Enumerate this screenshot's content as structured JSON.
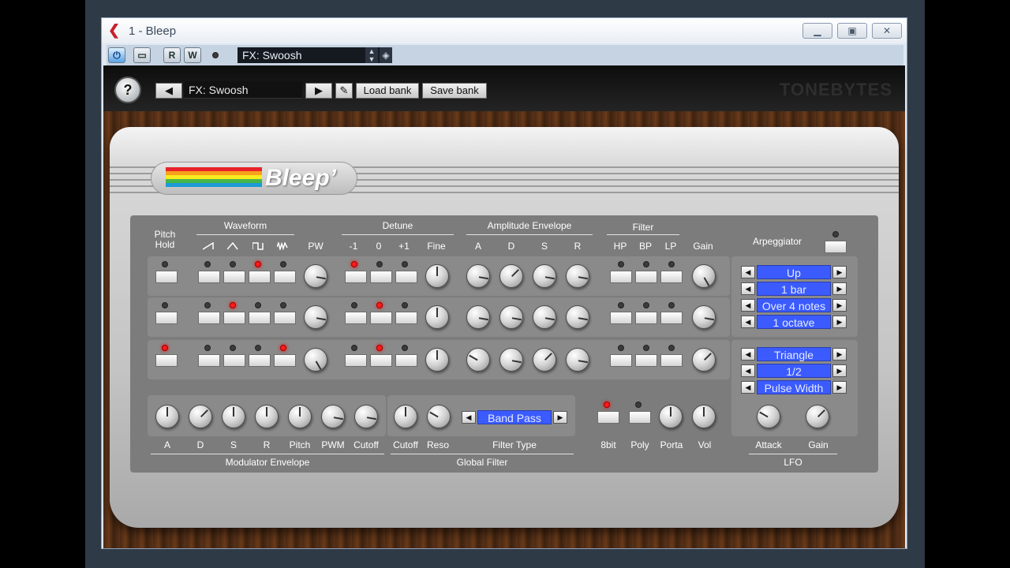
{
  "window": {
    "title": "1 - Bleep"
  },
  "toolbar": {
    "preset": "FX: Swoosh",
    "read_label": "R",
    "write_label": "W"
  },
  "plugin": {
    "preset_name": "FX: Swoosh",
    "load_label": "Load bank",
    "save_label": "Save bank",
    "brand": "TONEBYTES",
    "logo_text": "Bleep’"
  },
  "osc": {
    "pitch_hold_line1": "Pitch",
    "pitch_hold_line2": "Hold",
    "waveform_title": "Waveform",
    "pw_label": "PW",
    "detune_title": "Detune",
    "detune_labels": [
      "-1",
      "0",
      "+1"
    ],
    "fine_label": "Fine",
    "amp_env_title": "Amplitude Envelope",
    "amp_labels": [
      "A",
      "D",
      "S",
      "R"
    ],
    "filter_title": "Filter",
    "filter_labels": [
      "HP",
      "BP",
      "LP"
    ],
    "gain_label": "Gain"
  },
  "modulator": {
    "labels": [
      "A",
      "D",
      "S",
      "R",
      "Pitch",
      "PWM",
      "Cutoff"
    ],
    "title": "Modulator Envelope"
  },
  "global_filter": {
    "labels": [
      "Cutoff",
      "Reso"
    ],
    "filter_type": "Band Pass",
    "filter_type_label": "Filter Type",
    "title": "Global Filter"
  },
  "misc": {
    "labels": [
      "8bit",
      "Poly",
      "Porta",
      "Vol"
    ]
  },
  "arpeggiator": {
    "title": "Arpeggiator",
    "values": [
      "Up",
      "1 bar",
      "Over 4 notes",
      "1 octave"
    ]
  },
  "lfo": {
    "values": [
      "Triangle",
      "1/2",
      "Pulse Width"
    ],
    "attack_label": "Attack",
    "gain_label": "Gain",
    "title": "LFO"
  },
  "colors": {
    "led_on": "#ff1b1b",
    "lcd": "#3b5bff",
    "panel": "#7c7c7c"
  }
}
